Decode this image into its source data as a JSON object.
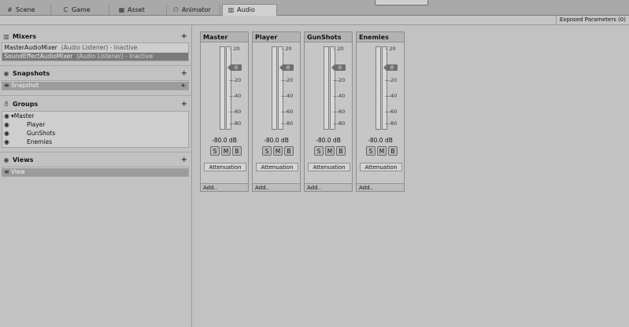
{
  "tabs": [
    {
      "icon": "#",
      "label": "Scene"
    },
    {
      "icon": "C",
      "label": "Game"
    },
    {
      "icon": "▦",
      "label": "Asset Store"
    },
    {
      "icon": "⚇",
      "label": "Animator"
    },
    {
      "icon": "▥",
      "label": "Audio Mixer"
    }
  ],
  "toolbar": {
    "exposed_label": "Exposed Parameters (0)"
  },
  "mixers": {
    "title": "Mixers",
    "items": [
      {
        "name": "MasterAudioMixer",
        "status": "(Audio Listener) - Inactive"
      },
      {
        "name": "SoundEffectAudioMixer",
        "status": "(Audio Listener) - Inactive"
      }
    ]
  },
  "snapshots": {
    "title": "Snapshots",
    "items": [
      {
        "name": "Snapshot"
      }
    ]
  },
  "groups": {
    "title": "Groups",
    "items": [
      {
        "name": "Master"
      },
      {
        "name": "Player"
      },
      {
        "name": "GunShots"
      },
      {
        "name": "Enemies"
      }
    ]
  },
  "views": {
    "title": "Views",
    "items": [
      {
        "name": "View"
      }
    ]
  },
  "scale_labels": [
    "20",
    "0",
    "-20",
    "-40",
    "-60",
    "-80"
  ],
  "strips": [
    {
      "name": "Master",
      "level_db": "-80.0 dB",
      "knob": "0",
      "solo": "S",
      "mute": "M",
      "bypass": "B",
      "effect": "Attenuation",
      "add": "Add.."
    },
    {
      "name": "Player",
      "level_db": "-80.0 dB",
      "knob": "0",
      "solo": "S",
      "mute": "M",
      "bypass": "B",
      "effect": "Attenuation",
      "add": "Add.."
    },
    {
      "name": "GunShots",
      "level_db": "-80.0 dB",
      "knob": "0",
      "solo": "S",
      "mute": "M",
      "bypass": "B",
      "effect": "Attenuation",
      "add": "Add.."
    },
    {
      "name": "Enemies",
      "level_db": "-80.0 dB",
      "knob": "0",
      "solo": "S",
      "mute": "M",
      "bypass": "B",
      "effect": "Attenuation",
      "add": "Add.."
    }
  ]
}
